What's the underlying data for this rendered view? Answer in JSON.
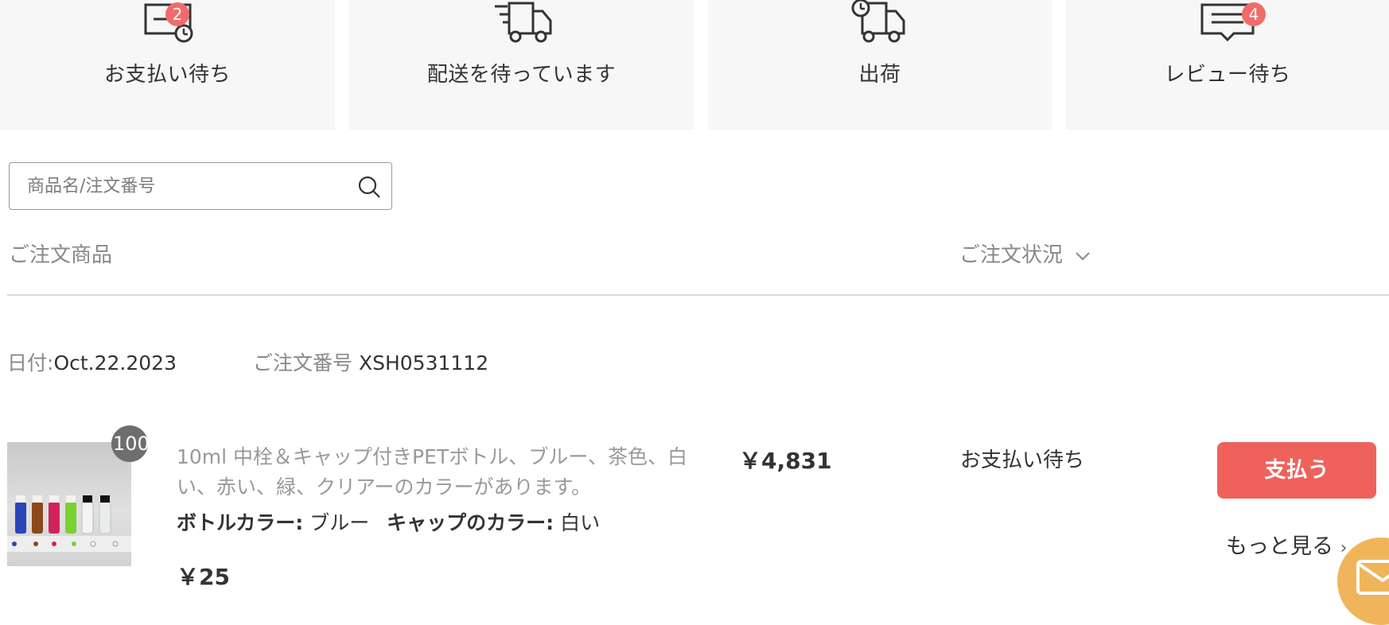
{
  "status_tabs": [
    {
      "label": "お支払い待ち",
      "badge": "2",
      "icon": "payment-pending-icon"
    },
    {
      "label": "配送を待っています",
      "badge": null,
      "icon": "delivery-truck-icon"
    },
    {
      "label": "出荷",
      "badge": null,
      "icon": "shipped-truck-icon"
    },
    {
      "label": "レビュー待ち",
      "badge": "4",
      "icon": "review-message-icon"
    }
  ],
  "search": {
    "placeholder": "商品名/注文番号",
    "icon": "search-icon"
  },
  "columns": {
    "product": "ご注文商品",
    "status": "ご注文状況"
  },
  "order": {
    "date_label": "日付:",
    "date": "Oct.22.2023",
    "number_label": "ご注文番号",
    "number": "XSH0531112",
    "item": {
      "quantity_badge": "100",
      "title": "10ml 中栓＆キャップ付きPETボトル、ブルー、茶色、白い、赤い、緑、クリアーのカラーがあります。",
      "bottle_color_label": "ボトルカラー:",
      "bottle_color": "ブルー",
      "cap_color_label": "キャップのカラー:",
      "cap_color": "白い",
      "unit_price": "￥25"
    },
    "total": "￥4,831",
    "status": "お支払い待ち",
    "pay_button": "支払う",
    "more_link": "もっと見る"
  },
  "colors": {
    "accent": "#ee625b",
    "badge": "#f26b6b",
    "card_bg": "#f7f7f7",
    "mail_fab": "#f0b55a"
  }
}
